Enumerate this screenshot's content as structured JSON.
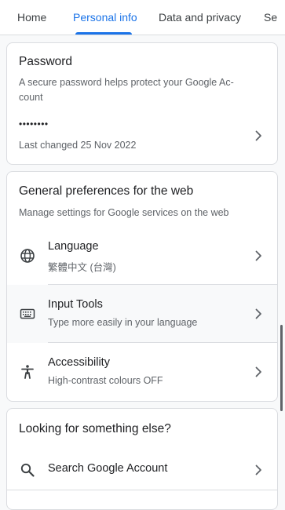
{
  "tabs": {
    "items": [
      {
        "label": "Home"
      },
      {
        "label": "Personal info"
      },
      {
        "label": "Data and privacy"
      },
      {
        "label": "Se"
      }
    ],
    "active": "Personal info",
    "accent_color": "#1a73e8"
  },
  "password": {
    "title": "Password",
    "description": "A secure password helps protect your Google Ac-count",
    "masked": "••••••••",
    "last_changed": "Last changed 25 Nov 2022"
  },
  "preferences": {
    "title": "General preferences for the web",
    "description": "Manage settings for Google services on the web",
    "items": [
      {
        "label": "Language",
        "value": "繁體中文 (台灣)",
        "icon": "globe-icon"
      },
      {
        "label": "Input Tools",
        "value": "Type more easily in your language",
        "icon": "keyboard-icon"
      },
      {
        "label": "Accessibility",
        "value": "High-contrast colours OFF",
        "icon": "accessibility-icon"
      }
    ]
  },
  "looking_else": {
    "title": "Looking for something else?",
    "items": [
      {
        "label": "Search Google Account",
        "icon": "search-icon"
      }
    ]
  }
}
